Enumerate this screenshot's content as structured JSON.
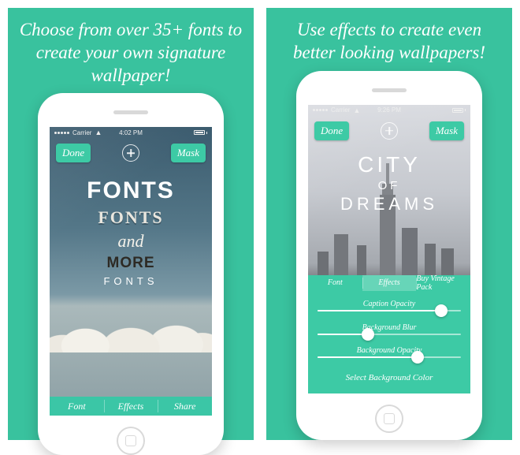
{
  "panels": [
    {
      "headline": "Choose from over 35+ fonts to create your own signature wallpaper!",
      "status": {
        "carrier": "Carrier",
        "time": "4:02 PM"
      },
      "topbar": {
        "done": "Done",
        "mask": "Mask"
      },
      "caption_lines": {
        "l1": "FONTS",
        "l2": "FONTS",
        "l3": "and",
        "l4": "MORE",
        "l5": "FONTS"
      },
      "bottom_tabs": {
        "font": "Font",
        "effects": "Effects",
        "share": "Share"
      }
    },
    {
      "headline": "Use effects to create even better looking wallpapers!",
      "status": {
        "carrier": "Carrier",
        "time": "9:26 PM"
      },
      "topbar": {
        "done": "Done",
        "mask": "Mask"
      },
      "caption_lines": {
        "l1": "CITY",
        "l2": "OF",
        "l3": "DREAMS"
      },
      "fx_tabs": {
        "font": "Font",
        "effects": "Effects",
        "buy": "Buy Vintage Pack"
      },
      "sliders": {
        "caption_opacity": {
          "label": "Caption Opacity",
          "value": 86
        },
        "background_blur": {
          "label": "Background Blur",
          "value": 35
        },
        "background_opacity": {
          "label": "Background Opacity",
          "value": 70
        }
      },
      "select_bg": "Select Background Color"
    }
  ]
}
